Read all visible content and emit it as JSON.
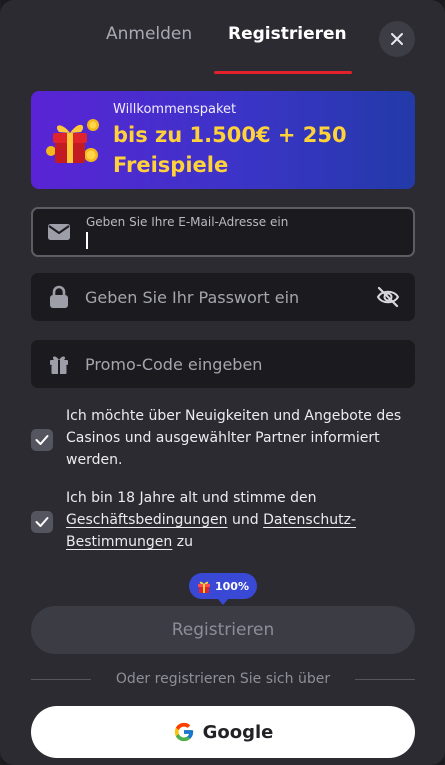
{
  "tabs": {
    "login": "Anmelden",
    "register": "Registrieren"
  },
  "close_icon": "close-icon",
  "banner": {
    "subtitle": "Willkommenspaket",
    "title": "bis zu 1.500€ + 250 Freispiele"
  },
  "fields": {
    "email_label": "Geben Sie Ihre E-Mail-Adresse ein",
    "password_placeholder": "Geben Sie Ihr Passwort ein",
    "promo_placeholder": "Promo-Code eingeben"
  },
  "consents": {
    "newsletter": "Ich möchte über Neuigkeiten und Angebote des Casinos und ausgewählter Partner informiert werden.",
    "terms_prefix": "Ich bin 18 Jahre alt und stimme den ",
    "terms_link": "Geschäftsbedingungen",
    "terms_and": " und ",
    "privacy_link": "Datenschutz-Bestimmungen",
    "terms_suffix": " zu"
  },
  "bonus_badge": "100%",
  "submit_label": "Registrieren",
  "divider_text": "Oder registrieren Sie sich über",
  "google_label": "Google",
  "colors": {
    "accent_red": "#e2212b",
    "banner_gold": "#ffd23a",
    "bonus_blue": "#3949d6"
  }
}
